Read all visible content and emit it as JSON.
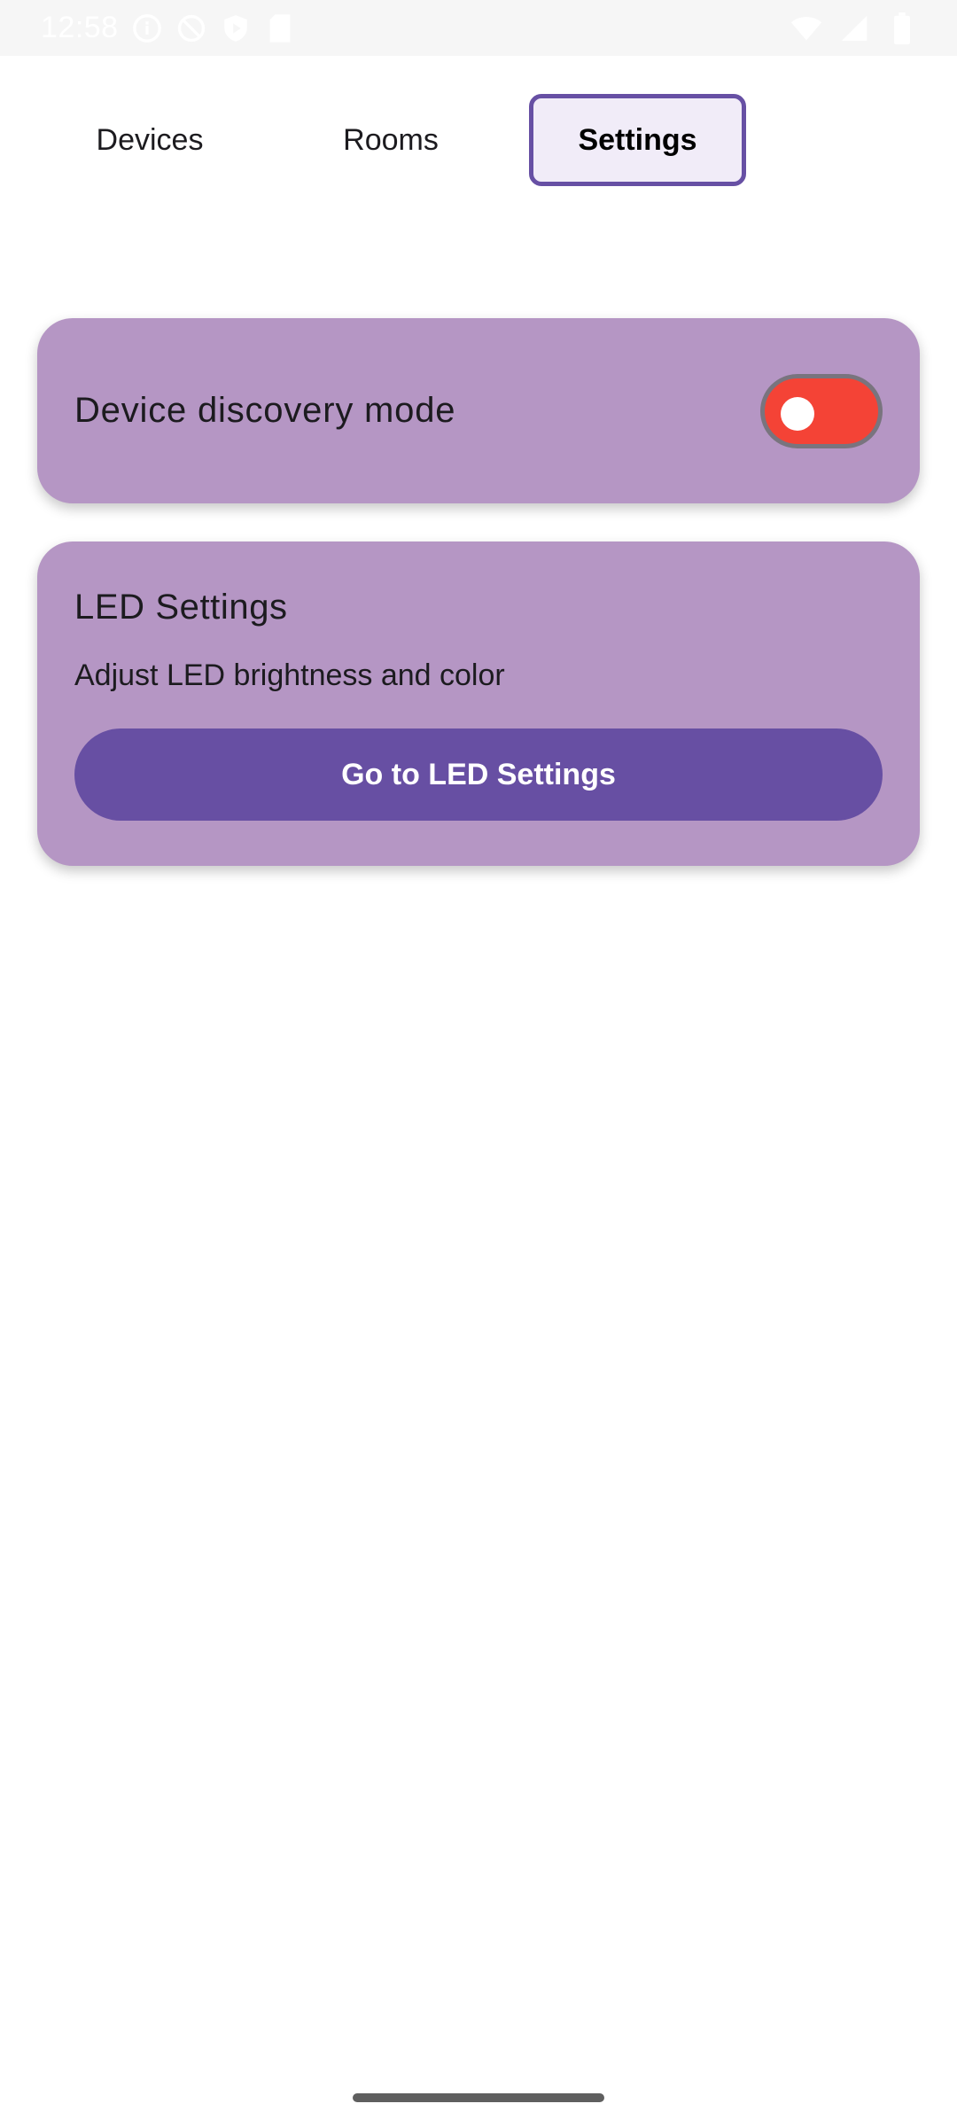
{
  "status_bar": {
    "time": "12:58",
    "left_icons": [
      "info-icon",
      "do-not-disturb-icon",
      "shield-play-icon",
      "sd-card-icon"
    ],
    "right_icons": [
      "wifi-icon",
      "cell-signal-icon",
      "battery-icon"
    ]
  },
  "tabs": [
    {
      "label": "Devices",
      "selected": false
    },
    {
      "label": "Rooms",
      "selected": false
    },
    {
      "label": "Settings",
      "selected": true
    }
  ],
  "discovery": {
    "label": "Device discovery mode",
    "enabled": false,
    "toggle_color": "#f44336"
  },
  "led": {
    "title": "LED Settings",
    "subtitle": "Adjust LED brightness and color",
    "button_label": "Go to LED Settings"
  },
  "colors": {
    "card_background": "#b596c4",
    "accent": "#6750a4",
    "button": "#674fa3"
  }
}
